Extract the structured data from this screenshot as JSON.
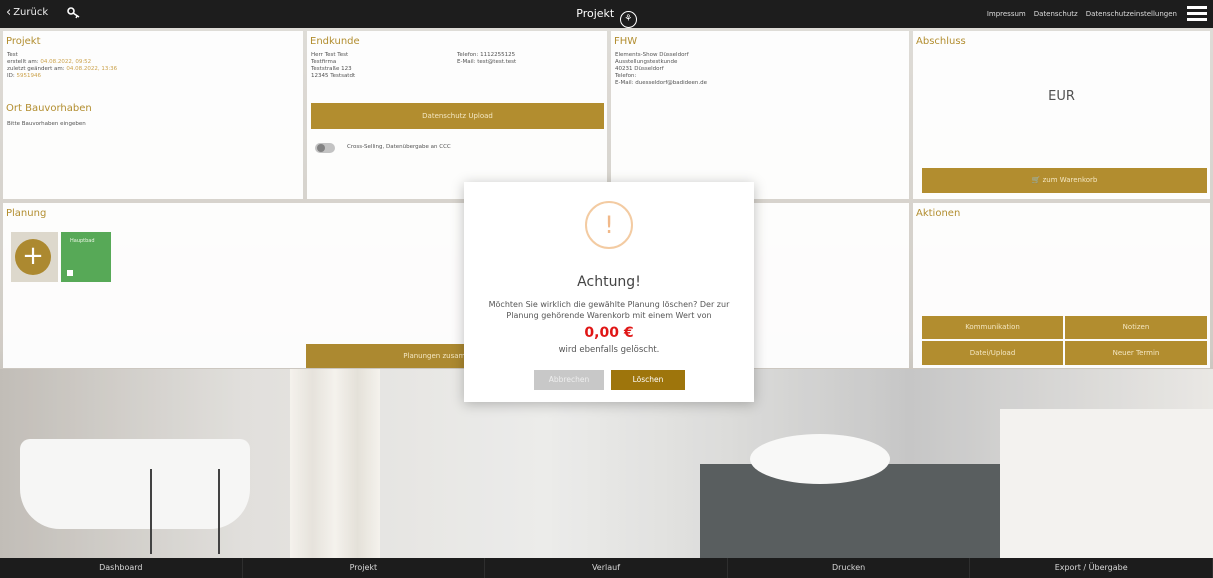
{
  "topbar": {
    "back_label": "Zurück",
    "title": "Projekt",
    "logo_text": "⚘",
    "links": [
      "Impressum",
      "Datenschutz",
      "Datenschutzeinstellungen"
    ]
  },
  "projekt": {
    "heading": "Projekt",
    "name": "Test",
    "created_label": "erstellt am:",
    "created_value": "04.08.2022, 09:52",
    "changed_label": "zuletzt geändert am:",
    "changed_value": "04.08.2022, 13:36",
    "id_label": "ID:",
    "id_value": "5951946",
    "ort_heading": "Ort Bauvorhaben",
    "ort_text": "Bitte Bauvorhaben eingeben"
  },
  "endkunde": {
    "heading": "Endkunde",
    "lines": [
      "Herr Test Test",
      "Testfirma",
      "Teststraße 123",
      "12345 Testsatdt"
    ],
    "phone": "Telefon: 1112255125",
    "email": "E-Mail: test@test.test",
    "upload_label": "Datenschutz Upload",
    "toggle_label": "Cross-Selling, Datenübergabe an CCC"
  },
  "fhw": {
    "heading": "FHW",
    "lines": [
      "Elements-Show Düsseldorf",
      "Ausstellungstestkunde",
      "40231 Düsseldorf",
      "Telefon:",
      "E-Mail: duesseldorf@badideen.de"
    ]
  },
  "abschluss": {
    "heading": "Abschluss",
    "currency": "EUR",
    "cart_label": "zum Warenkorb"
  },
  "planung": {
    "heading": "Planung",
    "add_label": "+",
    "item_label": "Hauptbad",
    "merge_label": "Planungen zusammenführen"
  },
  "aktionen": {
    "heading": "Aktionen",
    "buttons": [
      "Kommunikation",
      "Notizen",
      "Datei/Upload",
      "Neuer Termin"
    ]
  },
  "modal": {
    "icon": "!",
    "title": "Achtung!",
    "text": "Möchten Sie wirklich die gewählte Planung löschen? Der zur Planung gehörende Warenkorb mit einem Wert von",
    "price": "0,00 €",
    "sub": "wird ebenfalls gelöscht.",
    "cancel_label": "Abbrechen",
    "delete_label": "Löschen"
  },
  "bottomnav": [
    "Dashboard",
    "Projekt",
    "Verlauf",
    "Drucken",
    "Export / Übergabe"
  ]
}
